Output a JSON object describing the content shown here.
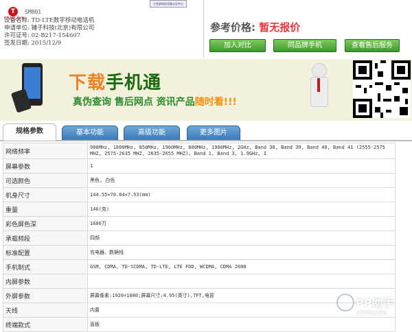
{
  "header": {
    "brand": "ETIANCAUN",
    "model": "SM801",
    "lines": [
      "设备名称: TD-LTE数字移动电话机",
      "申请单位: 锤子科技(北京)有限公司",
      "许可证号: 02-B217-154607",
      "签发日期: 2015/12/9"
    ],
    "cert_note": "工信部电信设备认证中心"
  },
  "price": {
    "label": "参考价格:",
    "value": "暂无报价"
  },
  "actions": [
    "加入对比",
    "同品牌手机",
    "查看售后服务"
  ],
  "banner": {
    "title_a": "下载",
    "title_b": "手机通",
    "subtitle_a": "真伪查询 售后网点 资讯产品",
    "subtitle_b": "随时看!!!"
  },
  "tabs": [
    "规格参数",
    "基本功能",
    "高级功能",
    "更多图片"
  ],
  "specs": [
    {
      "k": "网络频率",
      "v": "900MHz, 1800MHz, 850MHz, 1900MHz, 800MHz, 1900MHz, 2GHz, Band 38, Band 39, Band 40, Band 41 (2555-2575 MHZ, 2575-2635 MHZ, 2635-2655 MHZ), Band 1, Band 3, 1.9GHz, I"
    },
    {
      "k": "屏幕参数",
      "v": "1"
    },
    {
      "k": "可选颜色",
      "v": "黑色, 白色"
    },
    {
      "k": "机身尺寸",
      "v": "144.55×70.84×7.53(mm)"
    },
    {
      "k": "重量",
      "v": "146(克)"
    },
    {
      "k": "彩色屏色深",
      "v": "1600万"
    },
    {
      "k": "承载频段",
      "v": "四频"
    },
    {
      "k": "标准配置",
      "v": "充电器、数据线"
    },
    {
      "k": "手机制式",
      "v": "GSM, CDMA, TD-SCDMA, TD-LTE, LTE FDD, WCDMA, CDMA 2000"
    },
    {
      "k": "内屏参数",
      "v": ""
    },
    {
      "k": "外屏参数",
      "v": "屏幕像素:1920×1080;屏幕尺寸:4.95(英寸),TFT,电容"
    },
    {
      "k": "天线",
      "v": "内置"
    },
    {
      "k": "终端款式",
      "v": "直板"
    }
  ],
  "watermark": {
    "text": "PP助手",
    "url": "25PP.COM"
  }
}
